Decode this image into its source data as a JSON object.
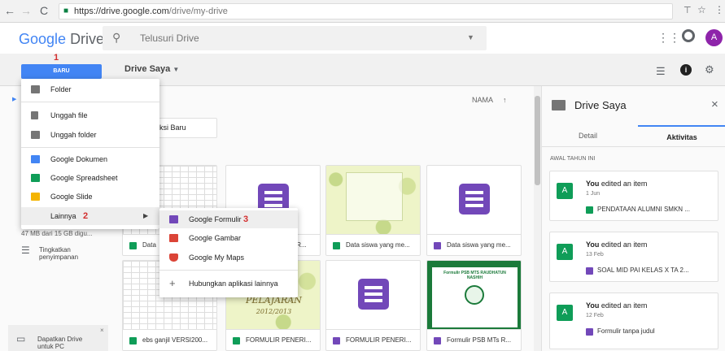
{
  "browser": {
    "url_host": "https://drive.google.com",
    "url_path": "/drive/my-drive"
  },
  "header": {
    "logo_google": "Google",
    "logo_drive": "Drive",
    "search_placeholder": "Telusuri Drive",
    "avatar_letter": "A"
  },
  "toolbar": {
    "new_button": "BARU",
    "new_step": "1",
    "location": "Drive Saya"
  },
  "new_menu": {
    "items": [
      {
        "label": "Folder",
        "icon": "folder-plus-icon"
      },
      {
        "label": "Unggah file",
        "icon": "file-upload-icon"
      },
      {
        "label": "Unggah folder",
        "icon": "folder-upload-icon"
      },
      {
        "label": "Google Dokumen",
        "icon": "docs-icon"
      },
      {
        "label": "Google Spreadsheet",
        "icon": "sheets-icon"
      },
      {
        "label": "Google Slide",
        "icon": "slides-icon"
      },
      {
        "label": "Lainnya",
        "icon": "more-icon"
      }
    ],
    "more_step": "2"
  },
  "sub_menu": {
    "items": [
      {
        "label": "Google Formulir",
        "icon": "forms-icon"
      },
      {
        "label": "Google Gambar",
        "icon": "drawings-icon"
      },
      {
        "label": "Google My Maps",
        "icon": "mymaps-icon"
      },
      {
        "label": "Hubungkan aplikasi lainnya",
        "icon": "plus-icon"
      }
    ],
    "forms_step": "3"
  },
  "sidebar": {
    "storage_text": "47 MB dari 15 GB digu...",
    "upgrade_label": "Tingkatkan penyimpanan",
    "get_drive_label": "Dapatkan Drive untuk PC"
  },
  "main": {
    "sort_label": "NAMA",
    "folder_chip": "oleksi Baru",
    "files_row1": [
      {
        "name": "Data",
        "type": "sheet"
      },
      {
        "name": "Data siswa yang me...",
        "type": "form"
      },
      {
        "name": "Data siswa yang me...",
        "type": "form"
      }
    ],
    "files_row1_partial": "s R...",
    "files_row2": [
      {
        "name": "ebs ganjil VERSI200...",
        "type": "sheet"
      },
      {
        "name": "FORMULIR PENERI...",
        "type": "sheet"
      },
      {
        "name": "FORMULIR PENERI...",
        "type": "form"
      },
      {
        "name": "Formulir PSB MTs R...",
        "type": "form"
      }
    ],
    "thumb_pelajaran": "PELAJARAN",
    "thumb_year": "2012/2013",
    "thumb_psb": "Formulir PSB MTS RAUDHATUN NASHIH"
  },
  "panel": {
    "title": "Drive Saya",
    "tab_detail": "Detail",
    "tab_activity": "Aktivitas",
    "section": "AWAL TAHUN INI",
    "activities": [
      {
        "who": "You",
        "action": "edited an item",
        "date": "1 Jun",
        "file": "PENDATAAN ALUMNI SMKN ...",
        "type": "sheet"
      },
      {
        "who": "You",
        "action": "edited an item",
        "date": "13 Feb",
        "file": "SOAL MID PAI KELAS X TA 2...",
        "type": "form"
      },
      {
        "who": "You",
        "action": "edited an item",
        "date": "12 Feb",
        "file": "Formulir tanpa judul",
        "type": "form"
      }
    ]
  },
  "colors": {
    "accent": "#4285f4",
    "sheets": "#0f9d58",
    "forms": "#7248b9",
    "slides": "#f4b400",
    "drawings": "#db4437",
    "step": "#d32f2f"
  }
}
